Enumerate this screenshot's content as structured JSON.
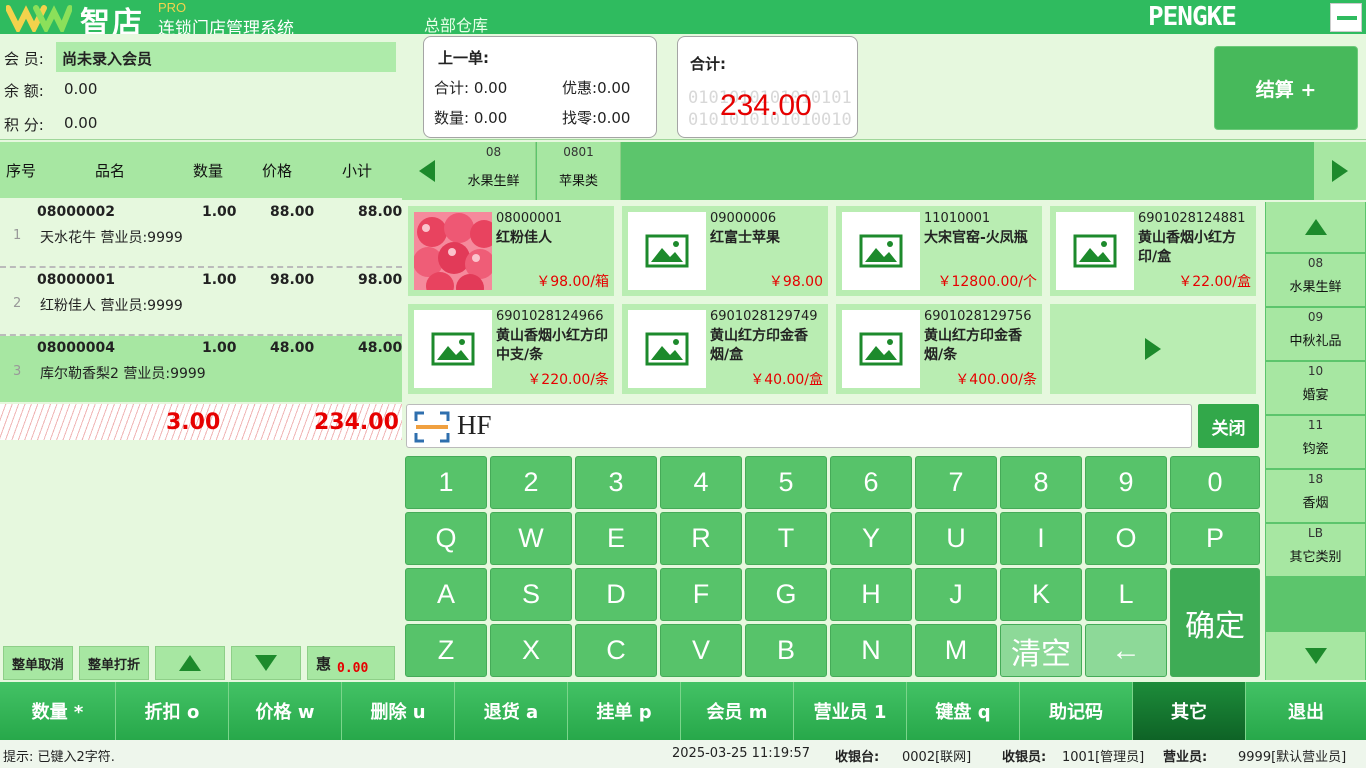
{
  "header": {
    "logo_name": "智店",
    "logo_pro": "PRO",
    "logo_subtitle": "连锁门店管理系统",
    "warehouse": "总部仓库",
    "brand": "PENGKE"
  },
  "member": {
    "member_label": "会 员:",
    "member_value": "尚未录入会员",
    "balance_label": "余 额:",
    "balance_value": "0.00",
    "points_label": "积 分:",
    "points_value": "0.00"
  },
  "last_order": {
    "title": "上一单:",
    "total_label": "合计:",
    "total_value": "0.00",
    "discount_label": "优惠:",
    "discount_value": "0.00",
    "qty_label": "数量:",
    "qty_value": "0.00",
    "change_label": "找零:",
    "change_value": "0.00"
  },
  "total_card": {
    "title": "合计:",
    "barcode_line1": "0101010101010101",
    "barcode_line2": "0101010101010010",
    "amount": "234.00"
  },
  "settle_label": "结算 +",
  "order_table": {
    "headers": [
      "序号",
      "品名",
      "数量",
      "价格",
      "小计"
    ],
    "rows": [
      {
        "index": "1",
        "code": "08000002",
        "qty": "1.00",
        "price": "88.00",
        "subtotal": "88.00",
        "name": "天水花牛 营业员:9999"
      },
      {
        "index": "2",
        "code": "08000001",
        "qty": "1.00",
        "price": "98.00",
        "subtotal": "98.00",
        "name": "红粉佳人 营业员:9999"
      },
      {
        "index": "3",
        "code": "08000004",
        "qty": "1.00",
        "price": "48.00",
        "subtotal": "48.00",
        "name": "库尔勒香梨2 营业员:9999"
      }
    ],
    "sum_qty": "3.00",
    "sum_amount": "234.00"
  },
  "order_buttons": {
    "cancel_all": "整单取消",
    "print_all": "整单打折",
    "discount_label": "惠",
    "discount_value": "0.00"
  },
  "categories": [
    {
      "code": "08",
      "name": "水果生鲜"
    },
    {
      "code": "0801",
      "name": "苹果类"
    }
  ],
  "products": [
    {
      "code": "08000001",
      "name": "红粉佳人",
      "price": "￥98.00/箱",
      "photo": true
    },
    {
      "code": "09000006",
      "name": "红富士苹果",
      "price": "￥98.00",
      "photo": false
    },
    {
      "code": "11010001",
      "name": "大宋官窑-火凤瓶",
      "price": "￥12800.00/个",
      "photo": false
    },
    {
      "code": "6901028124881",
      "name": "黄山香烟小红方印/盒",
      "price": "￥22.00/盒",
      "photo": false
    },
    {
      "code": "6901028124966",
      "name": "黄山香烟小红方印中支/条",
      "price": "￥220.00/条",
      "photo": false
    },
    {
      "code": "6901028129749",
      "name": "黄山红方印金香烟/盒",
      "price": "￥40.00/盒",
      "photo": false
    },
    {
      "code": "6901028129756",
      "name": "黄山红方印金香烟/条",
      "price": "￥400.00/条",
      "photo": false
    }
  ],
  "search": {
    "value": "HF",
    "close_label": "关闭"
  },
  "keyboard": {
    "row1": [
      "1",
      "2",
      "3",
      "4",
      "5",
      "6",
      "7",
      "8",
      "9",
      "0"
    ],
    "row2": [
      "Q",
      "W",
      "E",
      "R",
      "T",
      "Y",
      "U",
      "I",
      "O",
      "P"
    ],
    "row3": [
      "A",
      "S",
      "D",
      "F",
      "G",
      "H",
      "J",
      "K",
      "L"
    ],
    "row4": [
      "Z",
      "X",
      "C",
      "V",
      "B",
      "N",
      "M"
    ],
    "clear": "清空",
    "backspace": "←",
    "confirm": "确定"
  },
  "right_categories": [
    {
      "code": "08",
      "name": "水果生鲜"
    },
    {
      "code": "09",
      "name": "中秋礼品"
    },
    {
      "code": "10",
      "name": "婚宴"
    },
    {
      "code": "11",
      "name": "钧瓷"
    },
    {
      "code": "18",
      "name": "香烟"
    },
    {
      "code": "LB",
      "name": "其它类别"
    }
  ],
  "function_buttons": [
    "数量 *",
    "折扣 o",
    "价格 w",
    "删除 u",
    "退货 a",
    "挂单 p",
    "会员 m",
    "营业员 1",
    "键盘 q",
    "助记码",
    "其它",
    "退出"
  ],
  "status": {
    "hint": "提示: 已键入2字符.",
    "datetime": "2025-03-25 11:19:57",
    "register_label": "收银台:",
    "register_value": "0002[联网]",
    "cashier_label": "收银员:",
    "cashier_value": "1001[管理员]",
    "clerk_label": "营业员:",
    "clerk_value": "9999[默认营业员]"
  },
  "colors": {
    "primary": "#2fbb5f",
    "light": "#a7e7a2",
    "price_red": "#e60000"
  }
}
